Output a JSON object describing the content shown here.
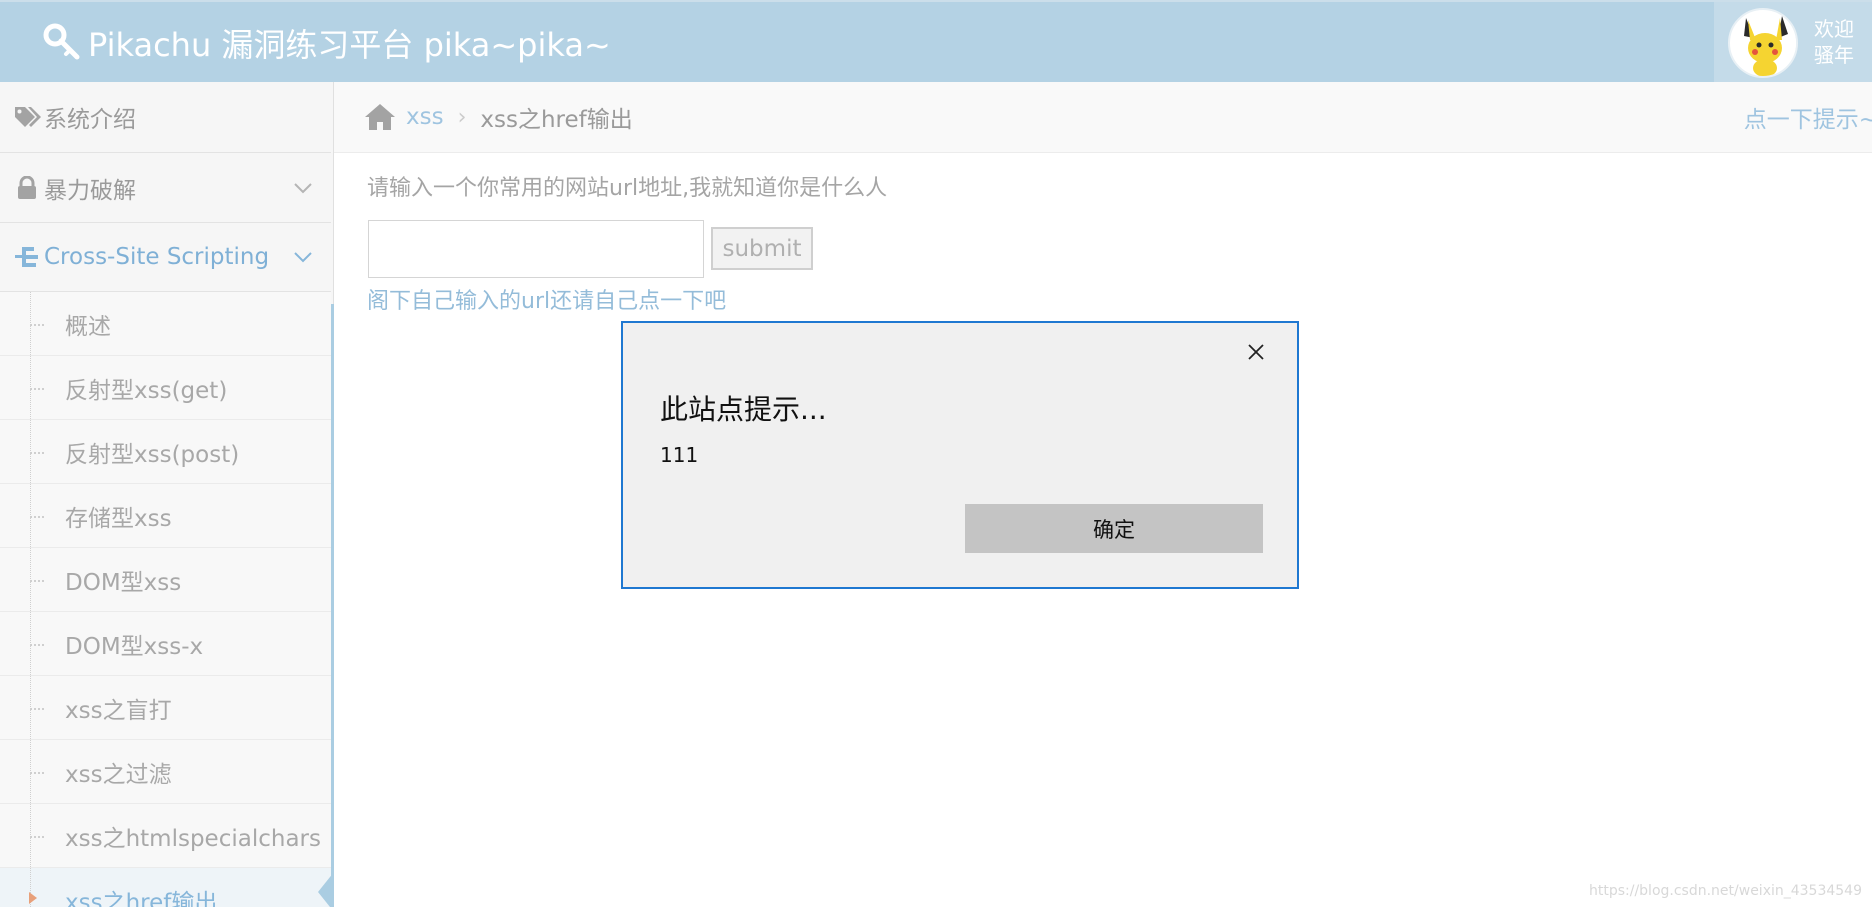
{
  "navbar": {
    "brand_title": "Pikachu 漏洞练习平台 pika~pika~",
    "welcome_line1": "欢迎",
    "welcome_line2": "骚年",
    "brand_icon": "key-icon",
    "avatar": "pikachu-avatar"
  },
  "sidebar": {
    "items": [
      {
        "label": "系统介绍",
        "icon": "tags-icon"
      },
      {
        "label": "暴力破解",
        "icon": "lock-icon"
      },
      {
        "label": "Cross-Site Scripting",
        "icon": "sitemap-icon"
      }
    ],
    "sub_items": [
      {
        "label": "概述"
      },
      {
        "label": "反射型xss(get)"
      },
      {
        "label": "反射型xss(post)"
      },
      {
        "label": "存储型xss"
      },
      {
        "label": "DOM型xss"
      },
      {
        "label": "DOM型xss-x"
      },
      {
        "label": "xss之盲打"
      },
      {
        "label": "xss之过滤"
      },
      {
        "label": "xss之htmlspecialchars"
      },
      {
        "label": "xss之href输出"
      }
    ]
  },
  "breadcrumb": {
    "level1": "xss",
    "separator": "›",
    "level2": "xss之href输出",
    "hint": "点一下提示~"
  },
  "main": {
    "prompt": "请输入一个你常用的网站url地址,我就知道你是什么人",
    "input_value": "",
    "submit_label": "submit",
    "result_link": "阁下自己输入的url还请自己点一下吧"
  },
  "dialog": {
    "title": "此站点提示...",
    "message": "111",
    "ok_label": "确定"
  },
  "watermark": "https://blog.csdn.net/weixin_43534549",
  "colors": {
    "navbar_bg": "#b4d2e4",
    "accent": "#86b6da",
    "dialog_border": "#1f78d1"
  }
}
